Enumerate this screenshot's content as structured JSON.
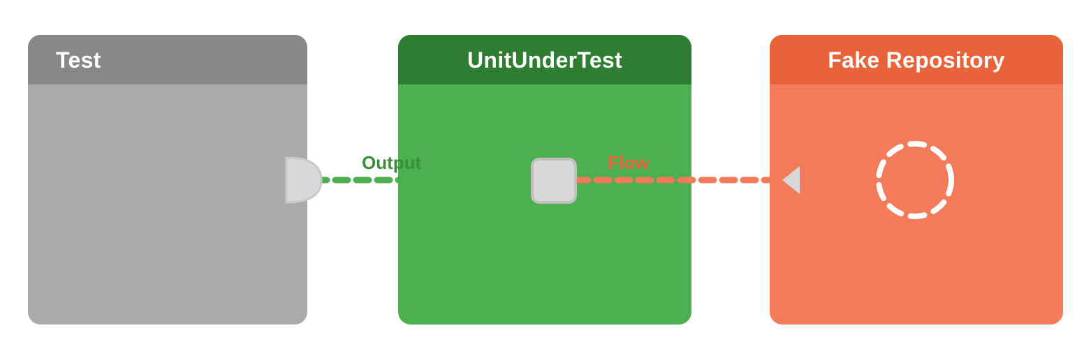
{
  "boxes": {
    "test": {
      "title": "Test",
      "header_color": "#888888",
      "body_color": "#aaaaaa"
    },
    "unit": {
      "title": "UnitUnderTest",
      "header_color": "#2e7d32",
      "body_color": "#4caf50"
    },
    "fake": {
      "title": "Fake Repository",
      "header_color": "#e8633a",
      "body_color": "#f47b5a"
    }
  },
  "labels": {
    "output": "Output",
    "flow": "Flow"
  },
  "colors": {
    "green_line": "#4caf50",
    "orange_line": "#f47b5a",
    "port_fill": "#d8d8d8",
    "port_stroke": "#c0c0c0"
  }
}
